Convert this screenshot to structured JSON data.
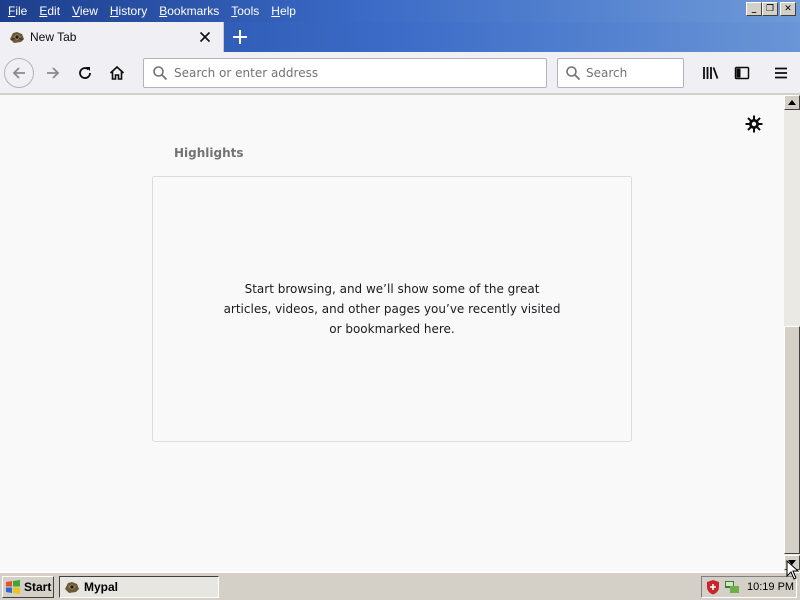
{
  "menubar": {
    "items": [
      "File",
      "Edit",
      "View",
      "History",
      "Bookmarks",
      "Tools",
      "Help"
    ]
  },
  "window_controls": {
    "minimize_glyph": "_",
    "restore_glyph": "❐",
    "close_glyph": "✕"
  },
  "tabs": [
    {
      "title": "New Tab",
      "favicon": "mypal-icon",
      "active": true
    }
  ],
  "newtab": {
    "glyph": "+"
  },
  "navbar": {
    "url_placeholder": "Search or enter address",
    "url_value": "",
    "search_placeholder": "Search",
    "search_value": ""
  },
  "content": {
    "highlights_title": "Highlights",
    "empty_message": "Start browsing, and we’ll show some of the great articles, videos, and other pages you’ve recently visited or bookmarked here."
  },
  "taskbar": {
    "start_label": "Start",
    "task_label": "Mypal",
    "clock": "10:19 PM"
  },
  "colors": {
    "titlebar_start": "#1d3e8c",
    "titlebar_end": "#6f9ad8",
    "toolbar_bg": "#f0f0f4",
    "content_bg": "#f9f9fa",
    "system_gray": "#d4d0c8"
  }
}
